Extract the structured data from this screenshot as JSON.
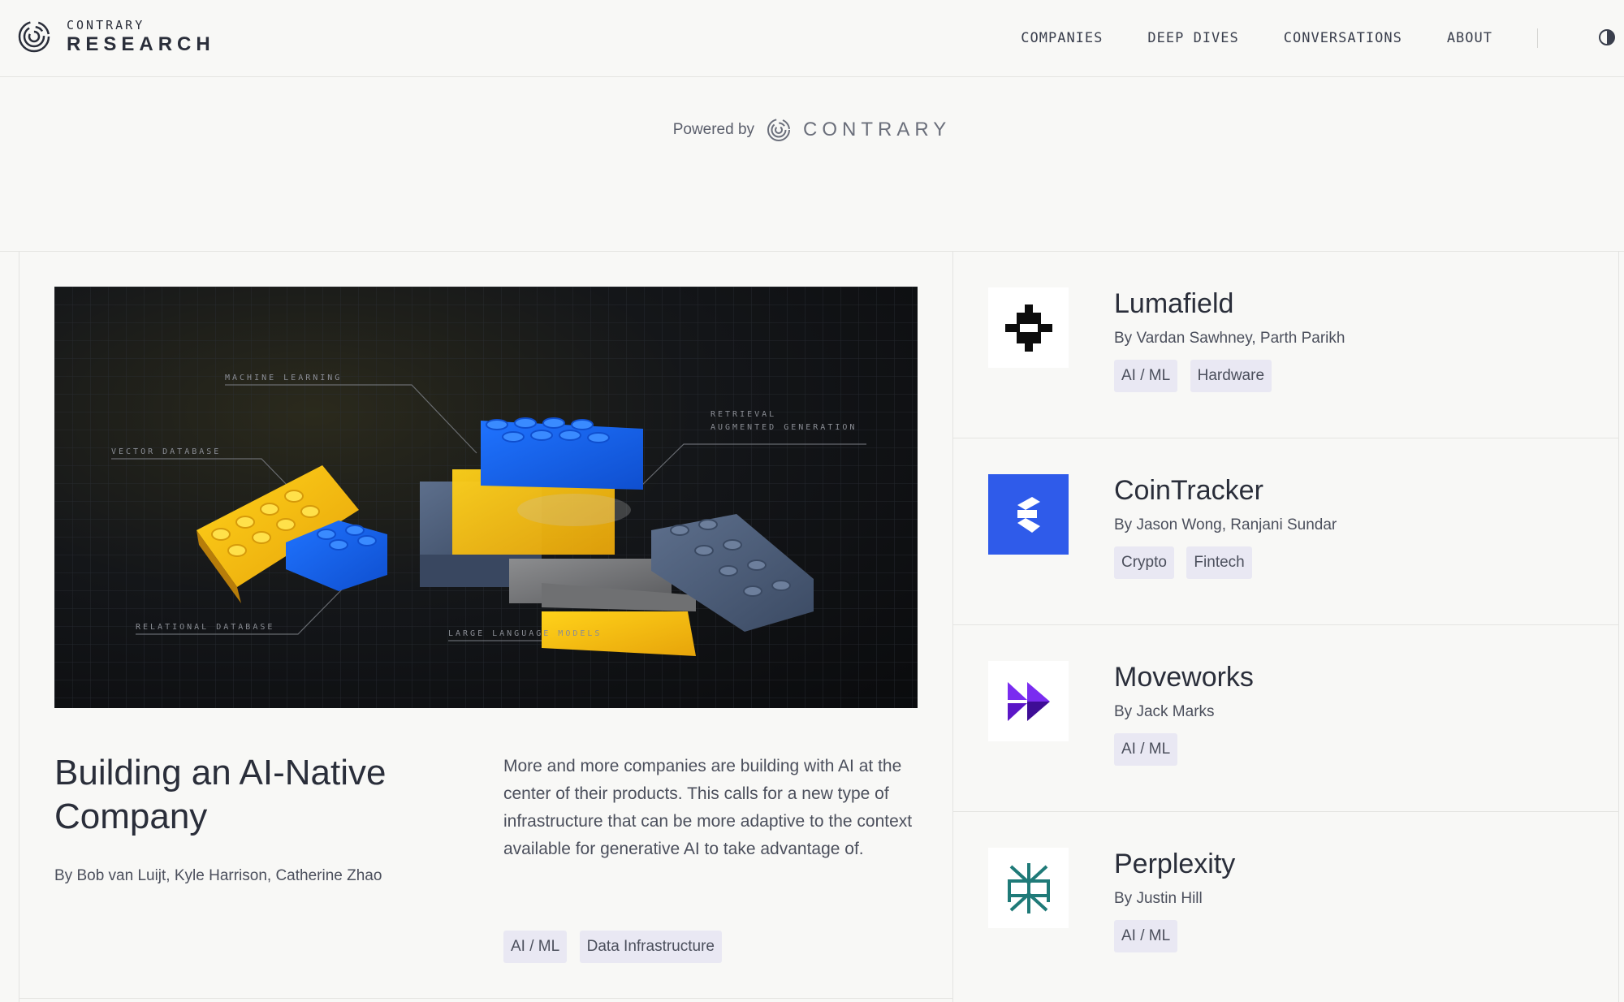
{
  "header": {
    "logo_top": "CONTRARY",
    "logo_bottom": "RESEARCH",
    "nav": [
      "COMPANIES",
      "DEEP DIVES",
      "CONVERSATIONS",
      "ABOUT"
    ]
  },
  "powered": {
    "label": "Powered by",
    "brand": "CONTRARY"
  },
  "feature": {
    "image_labels": {
      "machine_learning": "MACHINE LEARNING",
      "vector_database": "VECTOR DATABASE",
      "retrieval_1": "RETRIEVAL",
      "retrieval_2": "AUGMENTED GENERATION",
      "relational_database": "RELATIONAL DATABASE",
      "large_language_models": "LARGE LANGUAGE MODELS"
    },
    "title": "Building an AI-Native Company",
    "authors": "By Bob van Luijt, Kyle Harrison, Catherine Zhao",
    "description": "More and more companies are building with AI at the center of their products. This calls for a new type of infrastructure that can be more adaptive to the context available for generative AI to take advantage of.",
    "tags": [
      "AI / ML",
      "Data Infrastructure"
    ]
  },
  "cards": [
    {
      "name": "Lumafield",
      "authors": "By Vardan Sawhney, Parth Parikh",
      "tags": [
        "AI / ML",
        "Hardware"
      ],
      "icon": "lumafield-logo-icon"
    },
    {
      "name": "CoinTracker",
      "authors": "By Jason Wong, Ranjani Sundar",
      "tags": [
        "Crypto",
        "Fintech"
      ],
      "icon": "cointracker-logo-icon",
      "color": "#2f5bea"
    },
    {
      "name": "Moveworks",
      "authors": "By Jack Marks",
      "tags": [
        "AI / ML"
      ],
      "icon": "moveworks-logo-icon",
      "color": "#5b16c7"
    },
    {
      "name": "Perplexity",
      "authors": "By Justin Hill",
      "tags": [
        "AI / ML"
      ],
      "icon": "perplexity-logo-icon",
      "color": "#1f7a78"
    }
  ]
}
